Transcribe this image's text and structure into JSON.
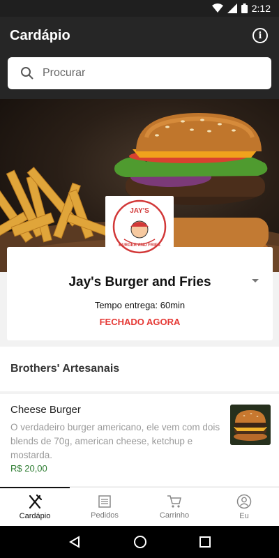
{
  "status_bar": {
    "time": "2:12"
  },
  "header": {
    "title": "Cardápio"
  },
  "search": {
    "placeholder": "Procurar"
  },
  "store": {
    "logo_text": "JAY'S BURGER AND FRIES",
    "name": "Jay's Burger and Fries",
    "delivery_time": "Tempo entrega: 60min",
    "status": "FECHADO AGORA"
  },
  "menu": {
    "section_title": "Brothers' Artesanais",
    "items": [
      {
        "name": "Cheese Burger",
        "description": "O verdadeiro burger americano, ele vem com dois blends de 70g, american cheese, ketchup e mostarda.",
        "price": "R$ 20,00"
      }
    ]
  },
  "bottom_nav": {
    "items": [
      {
        "label": "Cardápio",
        "icon": "fork-knife-icon",
        "active": true
      },
      {
        "label": "Pedidos",
        "icon": "list-icon",
        "active": false
      },
      {
        "label": "Carrinho",
        "icon": "cart-icon",
        "active": false
      },
      {
        "label": "Eu",
        "icon": "user-icon",
        "active": false
      }
    ]
  },
  "colors": {
    "header_bg": "#262626",
    "closed_status": "#e53935",
    "price": "#2e7d32"
  }
}
